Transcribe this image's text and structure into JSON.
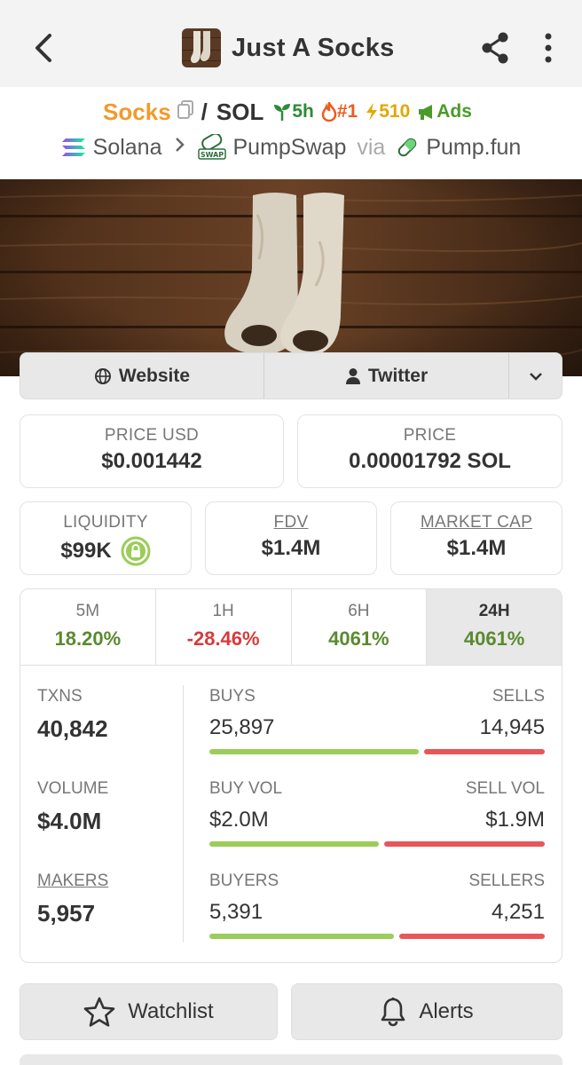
{
  "header": {
    "title": "Just A Socks",
    "icons": {
      "back": "back-arrow-icon",
      "share": "share-icon",
      "more": "more-vertical-icon"
    }
  },
  "pair": {
    "base_symbol": "Socks",
    "separator": "/",
    "quote_symbol": "SOL",
    "badges": {
      "age": "5h",
      "rank": "#1",
      "boosts": "510",
      "ads": "Ads"
    }
  },
  "chain": {
    "network": "Solana",
    "dex": "PumpSwap",
    "via": "via",
    "launchpad": "Pump.fun"
  },
  "links": {
    "website": "Website",
    "twitter": "Twitter"
  },
  "prices": {
    "price_usd_label": "PRICE USD",
    "price_usd": "$0.001442",
    "price_label": "PRICE",
    "price_native": "0.00001792 SOL"
  },
  "metrics": {
    "liquidity_label": "LIQUIDITY",
    "liquidity": "$99K",
    "fdv_label": "FDV",
    "fdv": "$1.4M",
    "mcap_label": "MARKET CAP",
    "mcap": "$1.4M"
  },
  "changes": [
    {
      "label": "5M",
      "value": "18.20%"
    },
    {
      "label": "1H",
      "value": "-28.46%"
    },
    {
      "label": "6H",
      "value": "4061%"
    },
    {
      "label": "24H",
      "value": "4061%"
    }
  ],
  "stats": {
    "txns_label": "TXNS",
    "txns": "40,842",
    "volume_label": "VOLUME",
    "volume": "$4.0M",
    "makers_label": "MAKERS",
    "makers": "5,957",
    "buys_label": "BUYS",
    "buys": "25,897",
    "sells_label": "SELLS",
    "sells": "14,945",
    "buy_vol_label": "BUY VOL",
    "buy_vol": "$2.0M",
    "sell_vol_label": "SELL VOL",
    "sell_vol": "$1.9M",
    "buyers_label": "BUYERS",
    "buyers": "5,391",
    "sellers_label": "SELLERS",
    "sellers": "4,251",
    "ratios": {
      "buys": 0.634,
      "buy_vol": 0.513,
      "buyers": 0.559
    }
  },
  "actions": {
    "watchlist": "Watchlist",
    "alerts": "Alerts"
  },
  "colors": {
    "accent_orange": "#f39a2b",
    "positive": "#5a8a30",
    "negative": "#d63b3b",
    "bar_green": "#9ccc5a",
    "bar_red": "#e8565a"
  }
}
